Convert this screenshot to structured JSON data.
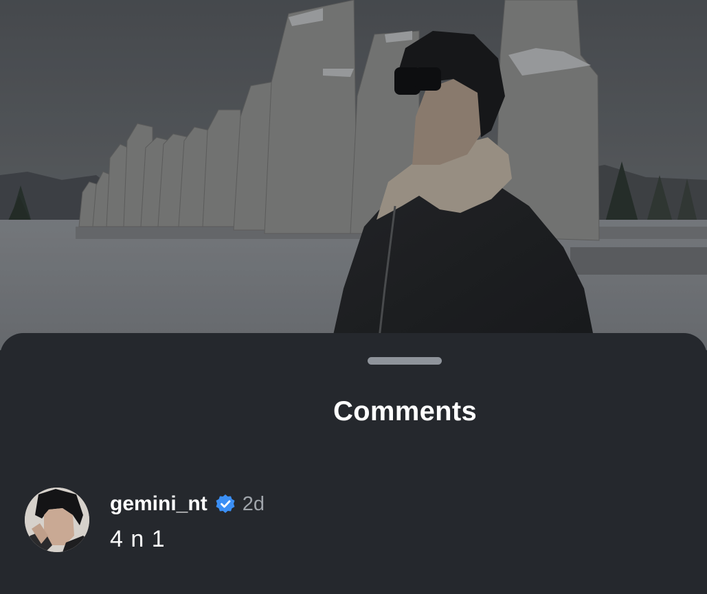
{
  "sheet": {
    "title": "Comments"
  },
  "comments": [
    {
      "username": "gemini_nt",
      "verified": true,
      "time": "2d",
      "text": "4 n 1"
    }
  ],
  "icons": {
    "verified": "verified-badge-icon",
    "handle": "drag-handle"
  },
  "colors": {
    "sheet_background": "#25282d",
    "verified_blue": "#3b8ff5",
    "secondary_text": "#a0a5ab"
  }
}
